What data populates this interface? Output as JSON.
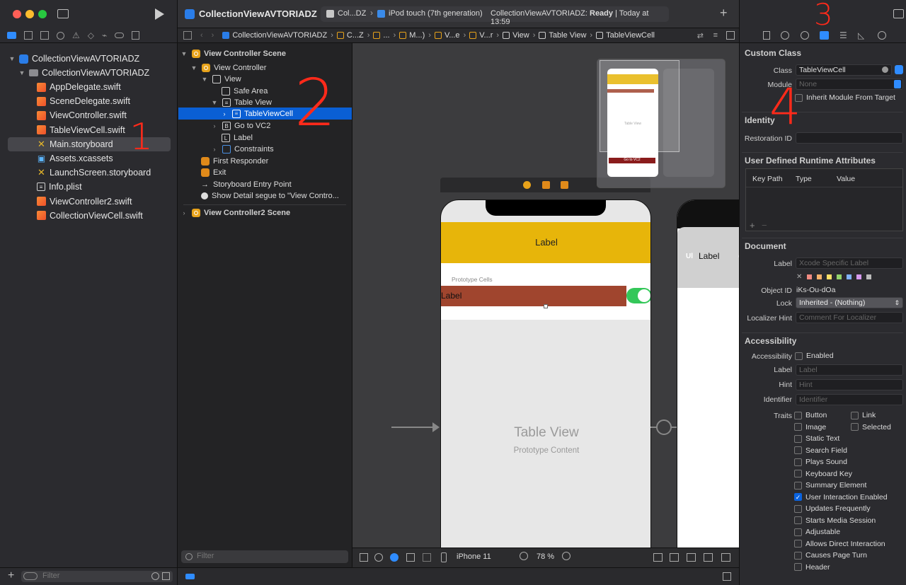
{
  "navigator": {
    "project": "CollectionViewAVTORIADZ",
    "group": "CollectionViewAVTORIADZ",
    "files": [
      {
        "name": "AppDelegate.swift",
        "kind": "swift"
      },
      {
        "name": "SceneDelegate.swift",
        "kind": "swift"
      },
      {
        "name": "ViewController.swift",
        "kind": "swift"
      },
      {
        "name": "TableViewCell.swift",
        "kind": "swift"
      },
      {
        "name": "Main.storyboard",
        "kind": "storyboard",
        "selected": true
      },
      {
        "name": "Assets.xcassets",
        "kind": "assets"
      },
      {
        "name": "LaunchScreen.storyboard",
        "kind": "storyboard"
      },
      {
        "name": "Info.plist",
        "kind": "plist"
      },
      {
        "name": "ViewController2.swift",
        "kind": "swift"
      },
      {
        "name": "CollectionViewCell.swift",
        "kind": "swift"
      }
    ],
    "filter_placeholder": "Filter"
  },
  "toolbar": {
    "project_title": "CollectionViewAVTORIADZ",
    "scheme": "Col...DZ",
    "device": "iPod touch (7th generation)",
    "status_prefix": "CollectionViewAVTORIADZ:",
    "status_state": "Ready",
    "status_time": "| Today at 13:59"
  },
  "jumpbar": {
    "items": [
      "CollectionViewAVTORIADZ",
      "C...Z",
      "...",
      "M...)",
      "V...e",
      "V...r",
      "View",
      "Table View",
      "TableViewCell"
    ]
  },
  "outline": {
    "scene1": "View Controller Scene",
    "vc": "View Controller",
    "view": "View",
    "safe_area": "Safe Area",
    "table_view": "Table View",
    "cell": "TableViewCell",
    "goto": "Go to VC2",
    "label": "Label",
    "constraints": "Constraints",
    "first_responder": "First Responder",
    "exit": "Exit",
    "entry": "Storyboard Entry Point",
    "segue": "Show Detail segue to \"View Contro...",
    "scene2": "View Controller2 Scene",
    "filter_placeholder": "Filter"
  },
  "canvas": {
    "header_label": "Label",
    "prototype_cells": "Prototype Cells",
    "cell_label": "Label",
    "table_view_title": "Table View",
    "table_view_sub": "Prototype Content",
    "second_label": "Label",
    "second_title_left": "Ul",
    "second_title_right": "ew",
    "mini_title": "Table View",
    "mini_btn": "Go to VC2"
  },
  "canvas_bar": {
    "device": "iPhone 11",
    "zoom": "78 %"
  },
  "inspector": {
    "custom_class_header": "Custom Class",
    "class_label": "Class",
    "class_value": "TableViewCell",
    "module_label": "Module",
    "module_value": "None",
    "inherit_label": "Inherit Module From Target",
    "identity_header": "Identity",
    "restoration_label": "Restoration ID",
    "udra_header": "User Defined Runtime Attributes",
    "col_keypath": "Key Path",
    "col_type": "Type",
    "col_value": "Value",
    "document_header": "Document",
    "doc_label": "Label",
    "doc_label_placeholder": "Xcode Specific Label",
    "object_id_label": "Object ID",
    "object_id": "iKs-Ou-dOa",
    "lock_label": "Lock",
    "lock_value": "Inherited - (Nothing)",
    "localizer_label": "Localizer Hint",
    "localizer_placeholder": "Comment For Localizer",
    "accessibility_header": "Accessibility",
    "acc_label": "Accessibility",
    "acc_enabled": "Enabled",
    "acc_label_label": "Label",
    "acc_label_placeholder": "Label",
    "hint_label": "Hint",
    "hint_placeholder": "Hint",
    "identifier_label": "Identifier",
    "identifier_placeholder": "Identifier",
    "traits_label": "Traits",
    "traits_left": [
      "Button",
      "Image",
      "Static Text",
      "Search Field",
      "Plays Sound",
      "Keyboard Key",
      "Summary Element",
      "User Interaction Enabled",
      "Updates Frequently",
      "Starts Media Session",
      "Adjustable",
      "Allows Direct Interaction",
      "Causes Page Turn",
      "Header"
    ],
    "traits_right": [
      "Link",
      "Selected"
    ],
    "traits_checked": [
      "User Interaction Enabled"
    ]
  },
  "annotations": [
    "1",
    "2",
    "3",
    "4"
  ],
  "colors": {
    "accent": "#0a5fd4",
    "header_yellow": "#e7b50a",
    "cell_brown": "#a0452e",
    "toggle_green": "#34c759",
    "annotation_red": "#ff2a1a"
  }
}
